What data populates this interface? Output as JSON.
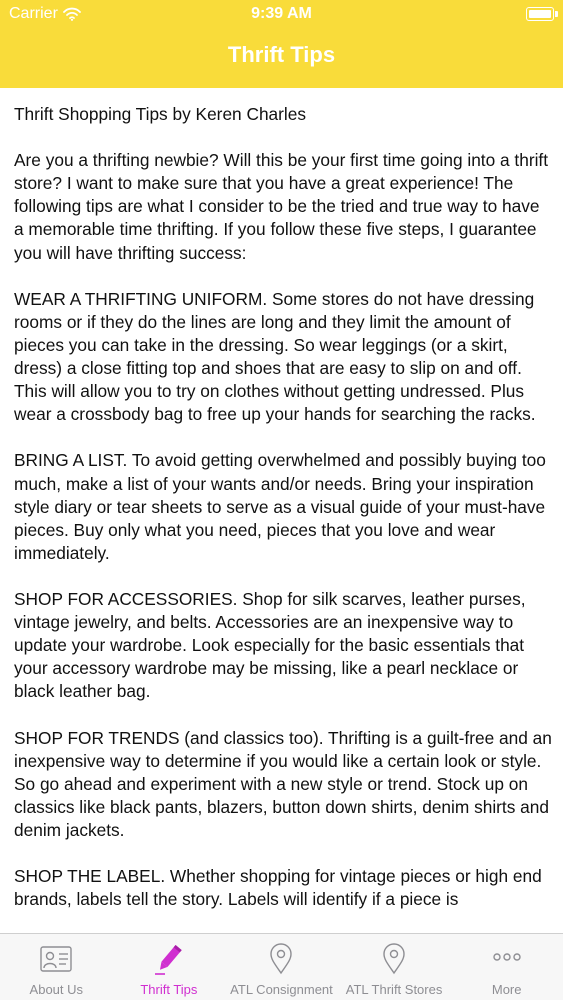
{
  "status_bar": {
    "carrier": "Carrier",
    "time": "9:39 AM"
  },
  "nav": {
    "title": "Thrift Tips"
  },
  "content": {
    "paragraphs": [
      "Thrift Shopping Tips by Keren Charles",
      "Are you a thrifting newbie? Will this be your first time going into a thrift store? I want to make sure that you have a great experience! The following tips are what I consider to be the tried and true way to have a memorable time thrifting. If you follow these five steps, I guarantee you will have thrifting success:",
      "WEAR A THRIFTING UNIFORM. Some stores do not have dressing rooms or if they do the lines are long and they limit the amount of pieces you can take in the dressing. So wear leggings (or a skirt, dress) a close fitting top and shoes that are easy to slip on and off. This will allow you to try on clothes without getting undressed. Plus wear a crossbody bag to free up your hands for searching the racks.",
      "BRING A LIST. To avoid getting overwhelmed and possibly buying too much, make a list of your wants and/or needs. Bring your inspiration style diary or tear sheets to serve as a visual guide of your must-have pieces. Buy only what you need, pieces that you love and wear immediately.",
      "SHOP FOR ACCESSORIES. Shop for silk scarves, leather purses, vintage jewelry, and belts. Accessories are an inexpensive way to update your wardrobe. Look especially for the basic essentials that your accessory wardrobe may be missing, like a pearl necklace or black leather bag.",
      "SHOP FOR TRENDS (and classics too). Thrifting is a guilt-free and an inexpensive way to determine if you would like a certain look or style. So go ahead and experiment with a new style or trend. Stock up on classics like black pants, blazers, button down shirts, denim shirts and denim jackets.",
      "SHOP THE LABEL. Whether shopping for vintage pieces or high end brands, labels tell the story. Labels will identify if a piece is"
    ]
  },
  "tabbar": {
    "items": [
      {
        "label": "About Us",
        "icon": "contact-card-icon"
      },
      {
        "label": "Thrift Tips",
        "icon": "pencil-icon"
      },
      {
        "label": "ATL Consignment",
        "icon": "map-pin-icon"
      },
      {
        "label": "ATL Thrift Stores",
        "icon": "map-pin-icon"
      },
      {
        "label": "More",
        "icon": "more-dots-icon"
      }
    ],
    "active_index": 1
  },
  "colors": {
    "header": "#f9dc3a",
    "active_tab": "#d02fd0",
    "inactive_tab": "#8e8e93"
  }
}
